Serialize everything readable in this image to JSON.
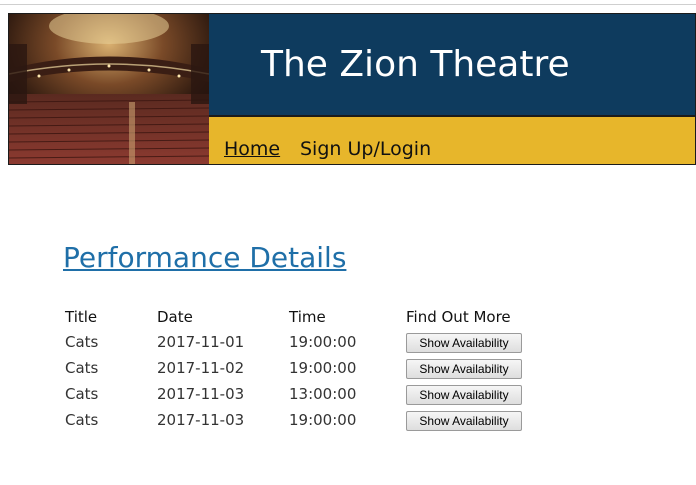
{
  "site": {
    "title": "The Zion Theatre"
  },
  "nav": {
    "items": [
      {
        "label": "Home"
      },
      {
        "label": "Sign Up/Login"
      }
    ]
  },
  "main": {
    "heading": "Performance Details",
    "table": {
      "columns": [
        "Title",
        "Date",
        "Time",
        "Find Out More"
      ],
      "rows": [
        {
          "title": "Cats",
          "date": "2017-11-01",
          "time": "19:00:00",
          "action": "Show Availability"
        },
        {
          "title": "Cats",
          "date": "2017-11-02",
          "time": "19:00:00",
          "action": "Show Availability"
        },
        {
          "title": "Cats",
          "date": "2017-11-03",
          "time": "13:00:00",
          "action": "Show Availability"
        },
        {
          "title": "Cats",
          "date": "2017-11-03",
          "time": "19:00:00",
          "action": "Show Availability"
        }
      ]
    }
  },
  "colors": {
    "header_navy": "#0e3b5e",
    "nav_gold": "#e7b62b",
    "link_blue": "#1f6fa8"
  },
  "icons": {
    "header_image": "theatre-auditorium-image"
  }
}
